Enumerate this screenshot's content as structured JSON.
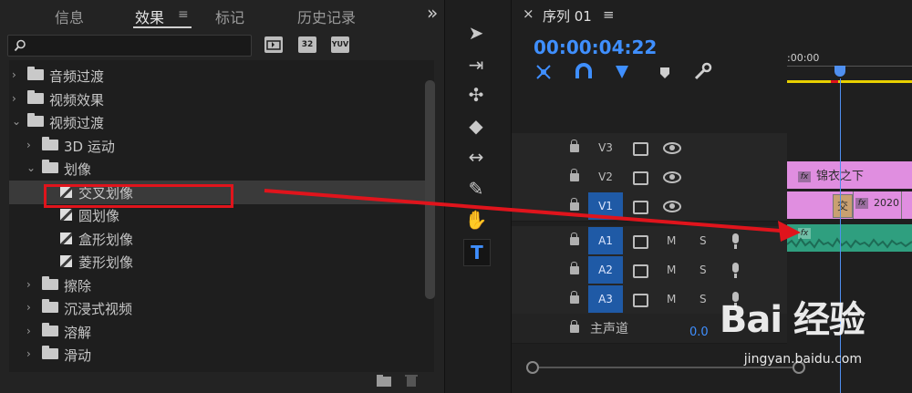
{
  "effects_panel": {
    "tabs": [
      "信息",
      "效果",
      "标记",
      "历史记录"
    ],
    "tab_menu_glyph": "≡",
    "overflow_glyph": "»",
    "search": {
      "value": "",
      "placeholder": ""
    },
    "filter_icons": [
      "accelerated-effects-icon",
      "32-bit-icon",
      "yuv-icon"
    ],
    "filter_labels": [
      "",
      "32",
      "YUV"
    ],
    "tree": [
      {
        "label": "音频过渡",
        "kind": "folder",
        "depth": 0,
        "expanded": false
      },
      {
        "label": "视频效果",
        "kind": "folder",
        "depth": 0,
        "expanded": false
      },
      {
        "label": "视频过渡",
        "kind": "folder",
        "depth": 0,
        "expanded": true
      },
      {
        "label": "3D 运动",
        "kind": "folder",
        "depth": 1,
        "expanded": false
      },
      {
        "label": "划像",
        "kind": "folder",
        "depth": 1,
        "expanded": true
      },
      {
        "label": "交叉划像",
        "kind": "effect",
        "depth": 2,
        "selected": true
      },
      {
        "label": "圆划像",
        "kind": "effect",
        "depth": 2
      },
      {
        "label": "盒形划像",
        "kind": "effect",
        "depth": 2
      },
      {
        "label": "菱形划像",
        "kind": "effect",
        "depth": 2
      },
      {
        "label": "擦除",
        "kind": "folder",
        "depth": 1,
        "expanded": false
      },
      {
        "label": "沉浸式视频",
        "kind": "folder",
        "depth": 1,
        "expanded": false
      },
      {
        "label": "溶解",
        "kind": "folder",
        "depth": 1,
        "expanded": false
      },
      {
        "label": "滑动",
        "kind": "folder",
        "depth": 1,
        "expanded": false
      }
    ]
  },
  "tools": [
    {
      "name": "selection-tool-icon",
      "glyph": "➤"
    },
    {
      "name": "track-select-tool-icon",
      "glyph": "⇥"
    },
    {
      "name": "ripple-edit-tool-icon",
      "glyph": "✣"
    },
    {
      "name": "razor-tool-icon",
      "glyph": "◆"
    },
    {
      "name": "slip-tool-icon",
      "glyph": "↔"
    },
    {
      "name": "pen-tool-icon",
      "glyph": "✎"
    },
    {
      "name": "hand-tool-icon",
      "glyph": "✋"
    },
    {
      "name": "type-tool-icon",
      "glyph": "T"
    }
  ],
  "timeline": {
    "close_glyph": "×",
    "sequence_name": "序列 01",
    "menu_glyph": "≡",
    "timecode": "00:00:04:22",
    "ruler_label": ":00:00",
    "tracks": [
      {
        "id": "V3",
        "type": "video",
        "targeted": false
      },
      {
        "id": "V2",
        "type": "video",
        "targeted": false
      },
      {
        "id": "V1",
        "type": "video",
        "targeted": true
      },
      {
        "id": "A1",
        "type": "audio",
        "targeted": true
      },
      {
        "id": "A2",
        "type": "audio",
        "targeted": true
      },
      {
        "id": "A3",
        "type": "audio",
        "targeted": true
      }
    ],
    "audio_controls": {
      "mute": "M",
      "solo": "S"
    },
    "master": {
      "label": "主声道",
      "value": "0.0"
    },
    "clips": {
      "v2_title": "锦衣之下",
      "v1_marker": "交",
      "v1_label": "2020",
      "fx_badge": "fx"
    }
  },
  "watermark": {
    "text": "Bai 经验",
    "url": "jingyan.baidu.com"
  },
  "colors": {
    "accent_blue": "#3f8fff",
    "clip_pink": "#e08ee0",
    "audio_green": "#2f9f7f",
    "annotation_red": "#e0141c",
    "work_area_yellow": "#e8d000"
  }
}
